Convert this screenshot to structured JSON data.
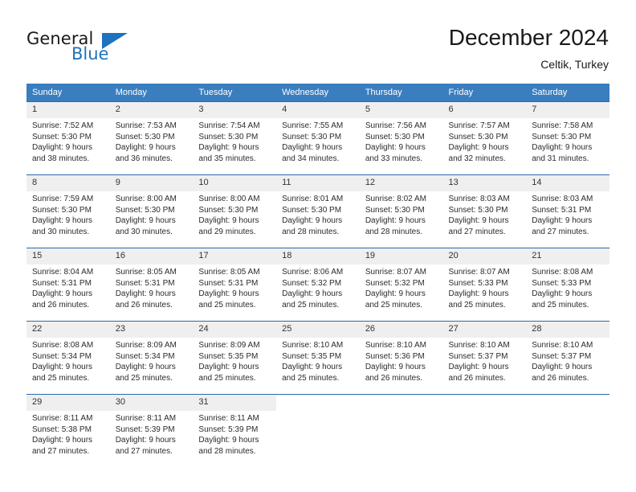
{
  "brand": {
    "name_part1": "General",
    "name_part2": "Blue",
    "logo_icon": "triangle-logo-icon"
  },
  "header": {
    "title": "December 2024",
    "subtitle": "Celtik, Turkey"
  },
  "colors": {
    "header_blue": "#3a7ebf",
    "row_divider_blue": "#2a6ba8",
    "daynum_band": "#efefef",
    "brand_blue": "#1f72bd",
    "text": "#222222"
  },
  "calendar": {
    "weekday_headers": [
      "Sunday",
      "Monday",
      "Tuesday",
      "Wednesday",
      "Thursday",
      "Friday",
      "Saturday"
    ],
    "labels": {
      "sunrise": "Sunrise:",
      "sunset": "Sunset:",
      "daylight": "Daylight:"
    },
    "weeks": [
      [
        {
          "day": "1",
          "sunrise": "Sunrise: 7:52 AM",
          "sunset": "Sunset: 5:30 PM",
          "daylight1": "Daylight: 9 hours",
          "daylight2": "and 38 minutes."
        },
        {
          "day": "2",
          "sunrise": "Sunrise: 7:53 AM",
          "sunset": "Sunset: 5:30 PM",
          "daylight1": "Daylight: 9 hours",
          "daylight2": "and 36 minutes."
        },
        {
          "day": "3",
          "sunrise": "Sunrise: 7:54 AM",
          "sunset": "Sunset: 5:30 PM",
          "daylight1": "Daylight: 9 hours",
          "daylight2": "and 35 minutes."
        },
        {
          "day": "4",
          "sunrise": "Sunrise: 7:55 AM",
          "sunset": "Sunset: 5:30 PM",
          "daylight1": "Daylight: 9 hours",
          "daylight2": "and 34 minutes."
        },
        {
          "day": "5",
          "sunrise": "Sunrise: 7:56 AM",
          "sunset": "Sunset: 5:30 PM",
          "daylight1": "Daylight: 9 hours",
          "daylight2": "and 33 minutes."
        },
        {
          "day": "6",
          "sunrise": "Sunrise: 7:57 AM",
          "sunset": "Sunset: 5:30 PM",
          "daylight1": "Daylight: 9 hours",
          "daylight2": "and 32 minutes."
        },
        {
          "day": "7",
          "sunrise": "Sunrise: 7:58 AM",
          "sunset": "Sunset: 5:30 PM",
          "daylight1": "Daylight: 9 hours",
          "daylight2": "and 31 minutes."
        }
      ],
      [
        {
          "day": "8",
          "sunrise": "Sunrise: 7:59 AM",
          "sunset": "Sunset: 5:30 PM",
          "daylight1": "Daylight: 9 hours",
          "daylight2": "and 30 minutes."
        },
        {
          "day": "9",
          "sunrise": "Sunrise: 8:00 AM",
          "sunset": "Sunset: 5:30 PM",
          "daylight1": "Daylight: 9 hours",
          "daylight2": "and 30 minutes."
        },
        {
          "day": "10",
          "sunrise": "Sunrise: 8:00 AM",
          "sunset": "Sunset: 5:30 PM",
          "daylight1": "Daylight: 9 hours",
          "daylight2": "and 29 minutes."
        },
        {
          "day": "11",
          "sunrise": "Sunrise: 8:01 AM",
          "sunset": "Sunset: 5:30 PM",
          "daylight1": "Daylight: 9 hours",
          "daylight2": "and 28 minutes."
        },
        {
          "day": "12",
          "sunrise": "Sunrise: 8:02 AM",
          "sunset": "Sunset: 5:30 PM",
          "daylight1": "Daylight: 9 hours",
          "daylight2": "and 28 minutes."
        },
        {
          "day": "13",
          "sunrise": "Sunrise: 8:03 AM",
          "sunset": "Sunset: 5:30 PM",
          "daylight1": "Daylight: 9 hours",
          "daylight2": "and 27 minutes."
        },
        {
          "day": "14",
          "sunrise": "Sunrise: 8:03 AM",
          "sunset": "Sunset: 5:31 PM",
          "daylight1": "Daylight: 9 hours",
          "daylight2": "and 27 minutes."
        }
      ],
      [
        {
          "day": "15",
          "sunrise": "Sunrise: 8:04 AM",
          "sunset": "Sunset: 5:31 PM",
          "daylight1": "Daylight: 9 hours",
          "daylight2": "and 26 minutes."
        },
        {
          "day": "16",
          "sunrise": "Sunrise: 8:05 AM",
          "sunset": "Sunset: 5:31 PM",
          "daylight1": "Daylight: 9 hours",
          "daylight2": "and 26 minutes."
        },
        {
          "day": "17",
          "sunrise": "Sunrise: 8:05 AM",
          "sunset": "Sunset: 5:31 PM",
          "daylight1": "Daylight: 9 hours",
          "daylight2": "and 25 minutes."
        },
        {
          "day": "18",
          "sunrise": "Sunrise: 8:06 AM",
          "sunset": "Sunset: 5:32 PM",
          "daylight1": "Daylight: 9 hours",
          "daylight2": "and 25 minutes."
        },
        {
          "day": "19",
          "sunrise": "Sunrise: 8:07 AM",
          "sunset": "Sunset: 5:32 PM",
          "daylight1": "Daylight: 9 hours",
          "daylight2": "and 25 minutes."
        },
        {
          "day": "20",
          "sunrise": "Sunrise: 8:07 AM",
          "sunset": "Sunset: 5:33 PM",
          "daylight1": "Daylight: 9 hours",
          "daylight2": "and 25 minutes."
        },
        {
          "day": "21",
          "sunrise": "Sunrise: 8:08 AM",
          "sunset": "Sunset: 5:33 PM",
          "daylight1": "Daylight: 9 hours",
          "daylight2": "and 25 minutes."
        }
      ],
      [
        {
          "day": "22",
          "sunrise": "Sunrise: 8:08 AM",
          "sunset": "Sunset: 5:34 PM",
          "daylight1": "Daylight: 9 hours",
          "daylight2": "and 25 minutes."
        },
        {
          "day": "23",
          "sunrise": "Sunrise: 8:09 AM",
          "sunset": "Sunset: 5:34 PM",
          "daylight1": "Daylight: 9 hours",
          "daylight2": "and 25 minutes."
        },
        {
          "day": "24",
          "sunrise": "Sunrise: 8:09 AM",
          "sunset": "Sunset: 5:35 PM",
          "daylight1": "Daylight: 9 hours",
          "daylight2": "and 25 minutes."
        },
        {
          "day": "25",
          "sunrise": "Sunrise: 8:10 AM",
          "sunset": "Sunset: 5:35 PM",
          "daylight1": "Daylight: 9 hours",
          "daylight2": "and 25 minutes."
        },
        {
          "day": "26",
          "sunrise": "Sunrise: 8:10 AM",
          "sunset": "Sunset: 5:36 PM",
          "daylight1": "Daylight: 9 hours",
          "daylight2": "and 26 minutes."
        },
        {
          "day": "27",
          "sunrise": "Sunrise: 8:10 AM",
          "sunset": "Sunset: 5:37 PM",
          "daylight1": "Daylight: 9 hours",
          "daylight2": "and 26 minutes."
        },
        {
          "day": "28",
          "sunrise": "Sunrise: 8:10 AM",
          "sunset": "Sunset: 5:37 PM",
          "daylight1": "Daylight: 9 hours",
          "daylight2": "and 26 minutes."
        }
      ],
      [
        {
          "day": "29",
          "sunrise": "Sunrise: 8:11 AM",
          "sunset": "Sunset: 5:38 PM",
          "daylight1": "Daylight: 9 hours",
          "daylight2": "and 27 minutes."
        },
        {
          "day": "30",
          "sunrise": "Sunrise: 8:11 AM",
          "sunset": "Sunset: 5:39 PM",
          "daylight1": "Daylight: 9 hours",
          "daylight2": "and 27 minutes."
        },
        {
          "day": "31",
          "sunrise": "Sunrise: 8:11 AM",
          "sunset": "Sunset: 5:39 PM",
          "daylight1": "Daylight: 9 hours",
          "daylight2": "and 28 minutes."
        },
        {
          "day": "",
          "sunrise": "",
          "sunset": "",
          "daylight1": "",
          "daylight2": ""
        },
        {
          "day": "",
          "sunrise": "",
          "sunset": "",
          "daylight1": "",
          "daylight2": ""
        },
        {
          "day": "",
          "sunrise": "",
          "sunset": "",
          "daylight1": "",
          "daylight2": ""
        },
        {
          "day": "",
          "sunrise": "",
          "sunset": "",
          "daylight1": "",
          "daylight2": ""
        }
      ]
    ]
  }
}
